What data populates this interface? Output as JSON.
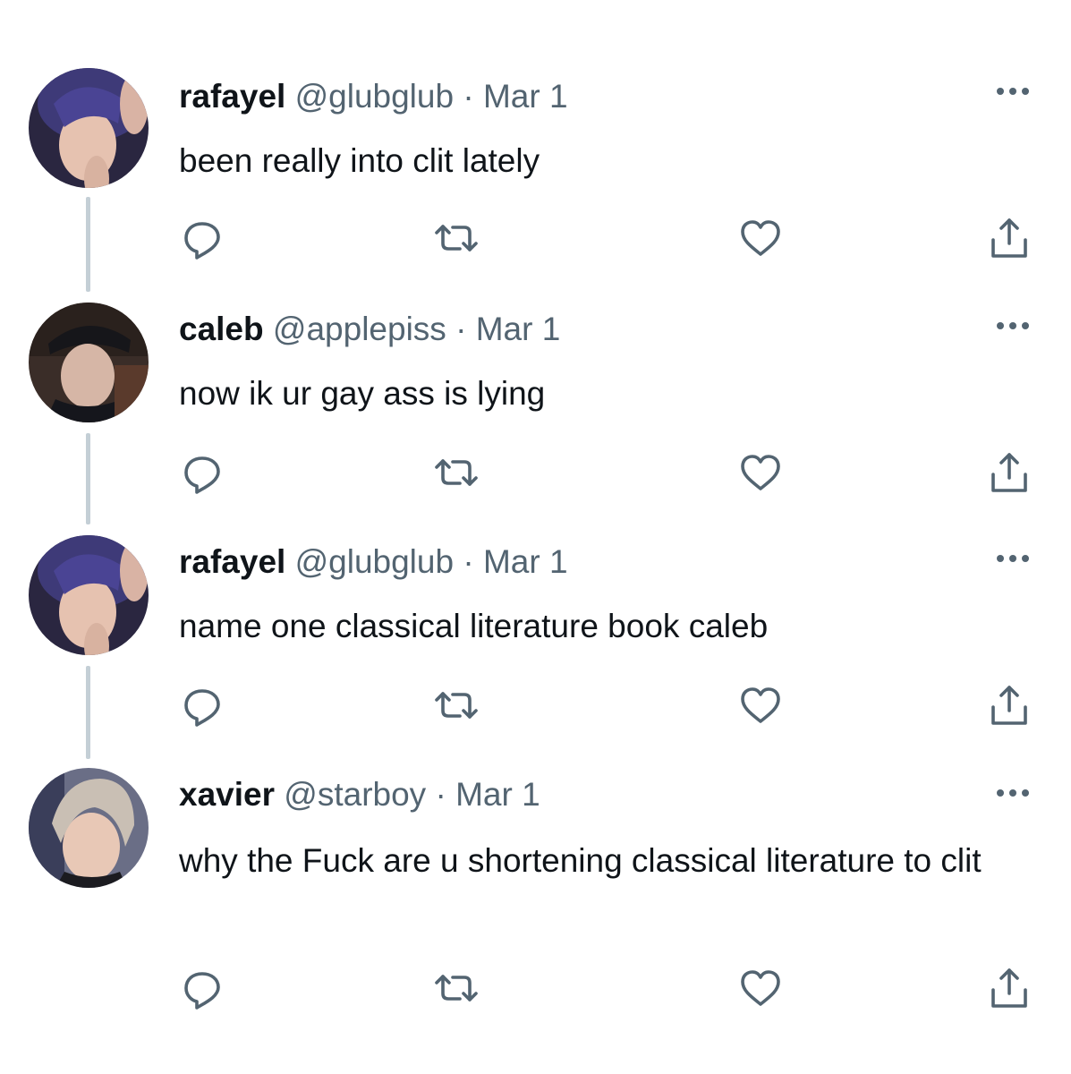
{
  "tweets": [
    {
      "name": "rafayel",
      "handle": "@glubglub",
      "separator": "·",
      "date": "Mar 1",
      "text": "been really into clit lately",
      "avatar": "avatar-rafayel"
    },
    {
      "name": "caleb",
      "handle": "@applepiss",
      "separator": "·",
      "date": "Mar 1",
      "text": "now ik ur gay ass is lying",
      "avatar": "avatar-caleb"
    },
    {
      "name": "rafayel",
      "handle": "@glubglub",
      "separator": "·",
      "date": "Mar 1",
      "text": "name one classical literature book caleb",
      "avatar": "avatar-rafayel"
    },
    {
      "name": "xavier",
      "handle": "@starboy",
      "separator": "·",
      "date": "Mar 1",
      "text": "why the Fuck are u shortening classical literature to clit",
      "avatar": "avatar-xavier"
    }
  ],
  "icons": {
    "reply": "reply-icon",
    "retweet": "retweet-icon",
    "like": "heart-icon",
    "share": "share-icon",
    "more": "more-icon"
  },
  "colors": {
    "text": "#0f1419",
    "secondary": "#536471",
    "connector": "#c4cfd6"
  }
}
